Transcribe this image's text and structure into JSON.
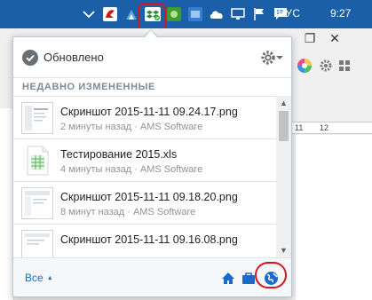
{
  "taskbar": {
    "language": "РУС",
    "time": "9:27",
    "tray_icons": [
      "chevron-up-icon",
      "antivirus-icon",
      "network-app-icon",
      "dropbox-icon",
      "green-app-icon",
      "blue-app-icon",
      "cloud-icon",
      "monitor-icon",
      "flag-icon",
      "chat-icon"
    ]
  },
  "background_window": {
    "restore_label": "❐",
    "close_label": "✕",
    "ruler_marks": [
      "11",
      "12"
    ]
  },
  "popup": {
    "status": "Обновлено",
    "section_title": "НЕДАВНО ИЗМЕНЕННЫЕ",
    "files": [
      {
        "name": "Скриншот 2015-11-11 09.24.17.png",
        "meta": "2 минуты назад · AMS Software",
        "type": "image"
      },
      {
        "name": "Тестирование 2015.xls",
        "meta": "4 минуты назад · AMS Software",
        "type": "spreadsheet"
      },
      {
        "name": "Скриншот 2015-11-11 09.18.20.png",
        "meta": "8 минут назад · AMS Software",
        "type": "image"
      },
      {
        "name": "Скриншот 2015-11-11 09.16.08.png",
        "meta": "",
        "type": "image"
      }
    ],
    "footer": {
      "all_label": "Все",
      "all_arrow": "▲"
    }
  },
  "colors": {
    "taskbar": "#1a5fa8",
    "accent": "#1b6ac9",
    "highlight": "#d9141e",
    "section_title": "#7e8b97",
    "meta": "#8a949e"
  }
}
